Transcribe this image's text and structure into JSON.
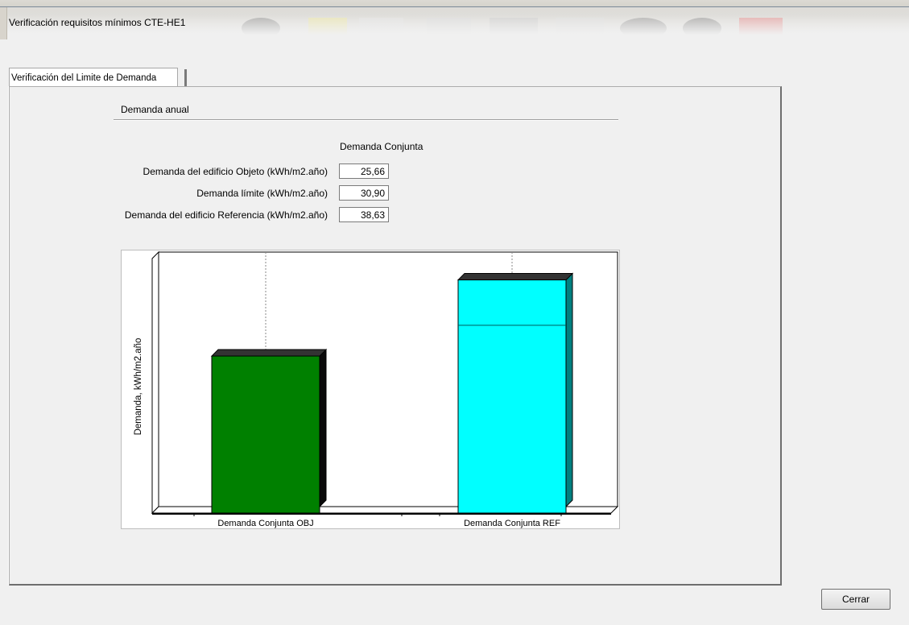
{
  "window": {
    "title": "Verificación requisitos mínimos CTE-HE1"
  },
  "tabs": [
    {
      "label": "Verificación del Limite de Demanda",
      "active": true
    }
  ],
  "section": {
    "title": "Demanda anual"
  },
  "table": {
    "column_header": "Demanda Conjunta",
    "rows": [
      {
        "label": "Demanda del edificio Objeto (kWh/m2.año)",
        "value": "25,66"
      },
      {
        "label": "Demanda límite (kWh/m2.año)",
        "value": "30,90"
      },
      {
        "label": "Demanda del edificio Referencia (kWh/m2.año)",
        "value": "38,63"
      }
    ]
  },
  "chart_data": {
    "type": "bar",
    "categories": [
      "Demanda Conjunta OBJ",
      "Demanda Conjunta REF"
    ],
    "values": [
      25.66,
      38.63
    ],
    "limit": 30.9,
    "ylabel": "Demanda, kWh/m2.año",
    "ylim": [
      0,
      42
    ],
    "bar_colors": [
      "#008000",
      "#00ffff"
    ],
    "grid": false,
    "legend": "none"
  },
  "footer": {
    "close_label": "Cerrar"
  },
  "colors": {
    "panel_bg": "#f0f0f0",
    "obj_bar": "#008000",
    "ref_bar": "#00ffff"
  }
}
